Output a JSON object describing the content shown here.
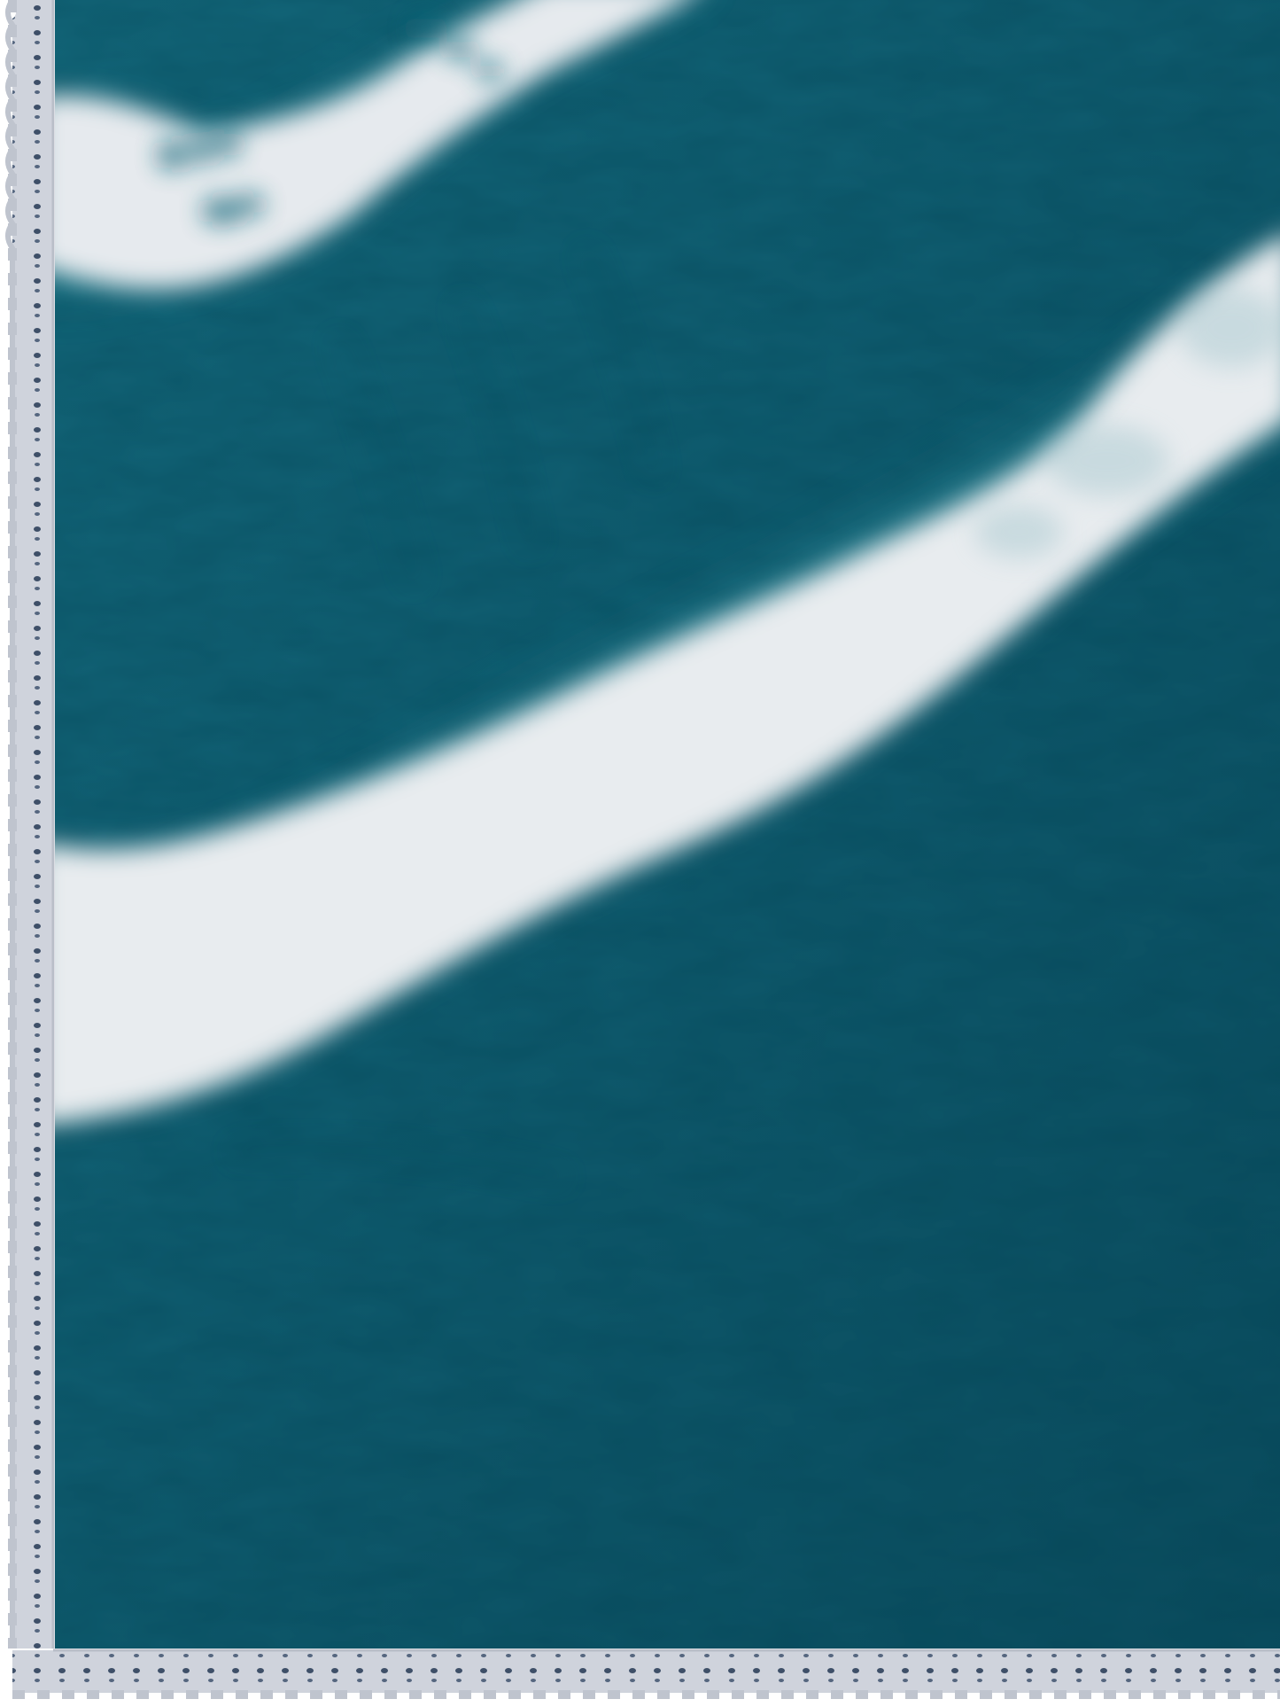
{
  "image": {
    "subject": "tie-dye-fabric-with-lace-border",
    "colors": {
      "dye": "#0f5a6c",
      "dye_dark": "#0a4658",
      "dye_light": "#1f7a8a",
      "stripe": "#e8ecef",
      "lace": "#c9cdd6",
      "lace_hole": "#3e4f68",
      "background": "#ffffff"
    }
  }
}
